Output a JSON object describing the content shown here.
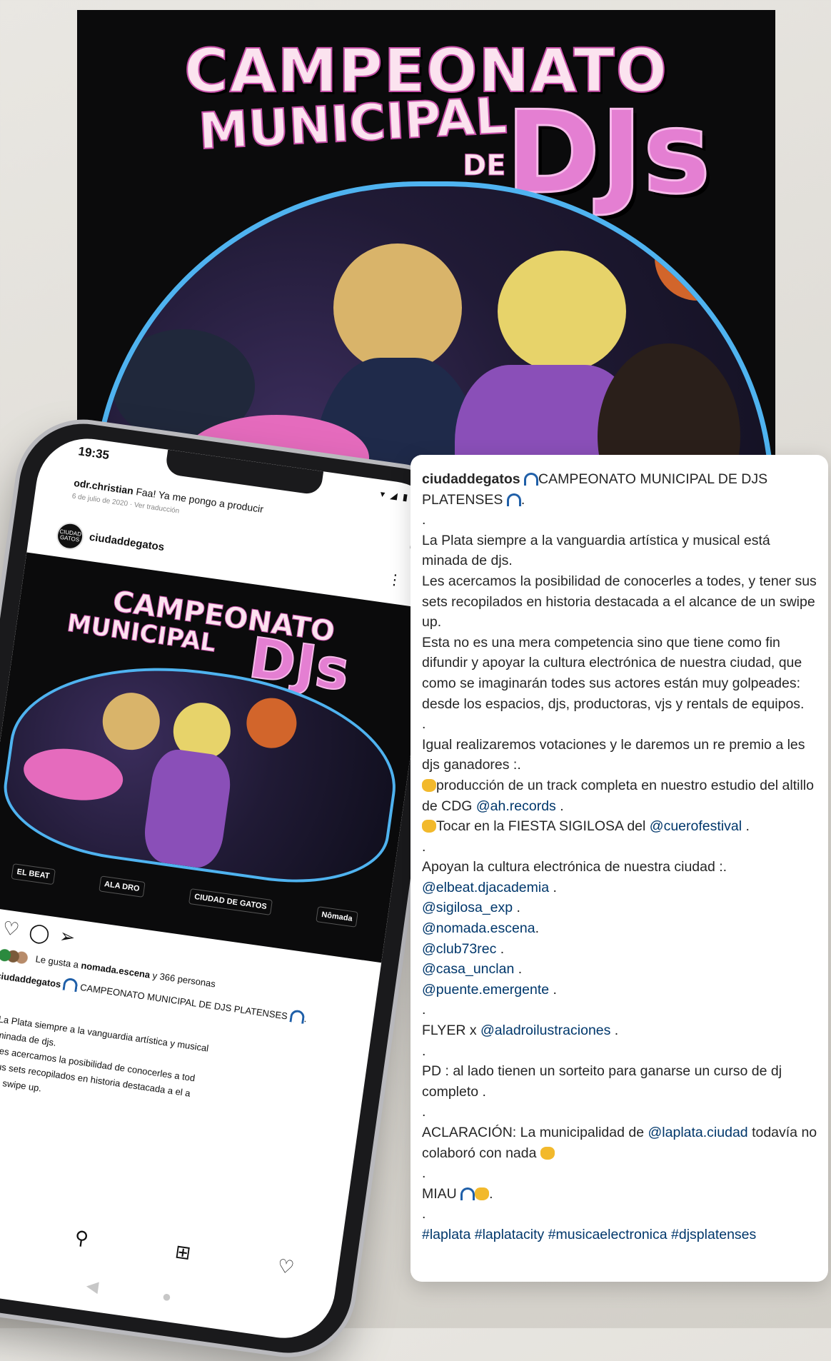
{
  "poster": {
    "title_line1": "CAMPEONATO",
    "title_line2": "MUNICIPAL",
    "title_de": "DE",
    "title_djs": "DJs"
  },
  "phone": {
    "status_time": "19:35",
    "status_icons": "▾ ◢ ▮",
    "comment": {
      "user": "odr.christian",
      "text": "Faa! Ya me pongo a producir",
      "meta": "6 de julio de 2020 · Ver traducción"
    },
    "post_user": "ciudaddegatos",
    "avatar_text": "CIUDAD GATOS",
    "image": {
      "title_line1": "CAMPEONATO",
      "title_line2": "MUNICIPAL",
      "title_djs": "DJs",
      "sponsors": [
        "ALA DRO",
        "CIUDAD DE GATOS",
        "Nômada",
        "EL BEAT"
      ]
    },
    "likes": {
      "prefix": "Le gusta a",
      "user": "nomada.escena",
      "suffix": "y 366 personas"
    },
    "caption_user": "ciudaddegatos",
    "caption_title": "CAMPEONATO MUNICIPAL DE DJS PLATENSES",
    "caption_lines": [
      "La Plata siempre a la vanguardia artística y musical",
      "minada de djs.",
      "Les acercamos la posibilidad de conocerles a tod",
      "sus sets recopilados en historia destacada a el a",
      "un swipe up."
    ]
  },
  "card": {
    "user": "ciudaddegatos",
    "title": "CAMPEONATO MUNICIPAL DE DJS PLATENSES",
    "para1": "La Plata siempre a la vanguardia artística y musical está minada de djs.",
    "para2": "Les acercamos la posibilidad de conocerles a todes, y tener sus sets recopilados en historia destacada a el alcance de un swipe up.",
    "para3": "Esta no es una mera competencia sino que tiene como fin difundir y apoyar la cultura electrónica de nuestra ciudad, que como se imaginarán todes sus actores están muy golpeades: desde los espacios, djs, productoras, vjs y rentals de equipos.",
    "para4": "Igual realizaremos votaciones y le daremos un re premio a les djs ganadores :.",
    "prize1_text": "producción de un track completa en nuestro estudio del altillo de CDG",
    "prize1_mention": "@ah.records",
    "prize2_text": "Tocar en la FIESTA SIGILOSA del",
    "prize2_mention": "@cuerofestival",
    "support_intro": "Apoyan la cultura electrónica de nuestra ciudad :.",
    "supporters": [
      "@elbeat.djacademia",
      "@sigilosa_exp",
      "@nomada.escena",
      "@club73rec",
      "@casa_unclan",
      "@puente.emergente"
    ],
    "flyer_prefix": "FLYER x",
    "flyer_mention": "@aladroilustraciones",
    "pd": "PD : al lado tienen un sorteito para ganarse un curso de dj completo .",
    "aclaracion_prefix": "ACLARACIÓN: La municipalidad de",
    "aclaracion_mention": "@laplata.ciudad",
    "aclaracion_suffix": "todavía no colaboró con nada",
    "miau": "MIAU",
    "hashtags": "#laplata #laplatacity #musicaelectronica #djsplatenses"
  }
}
